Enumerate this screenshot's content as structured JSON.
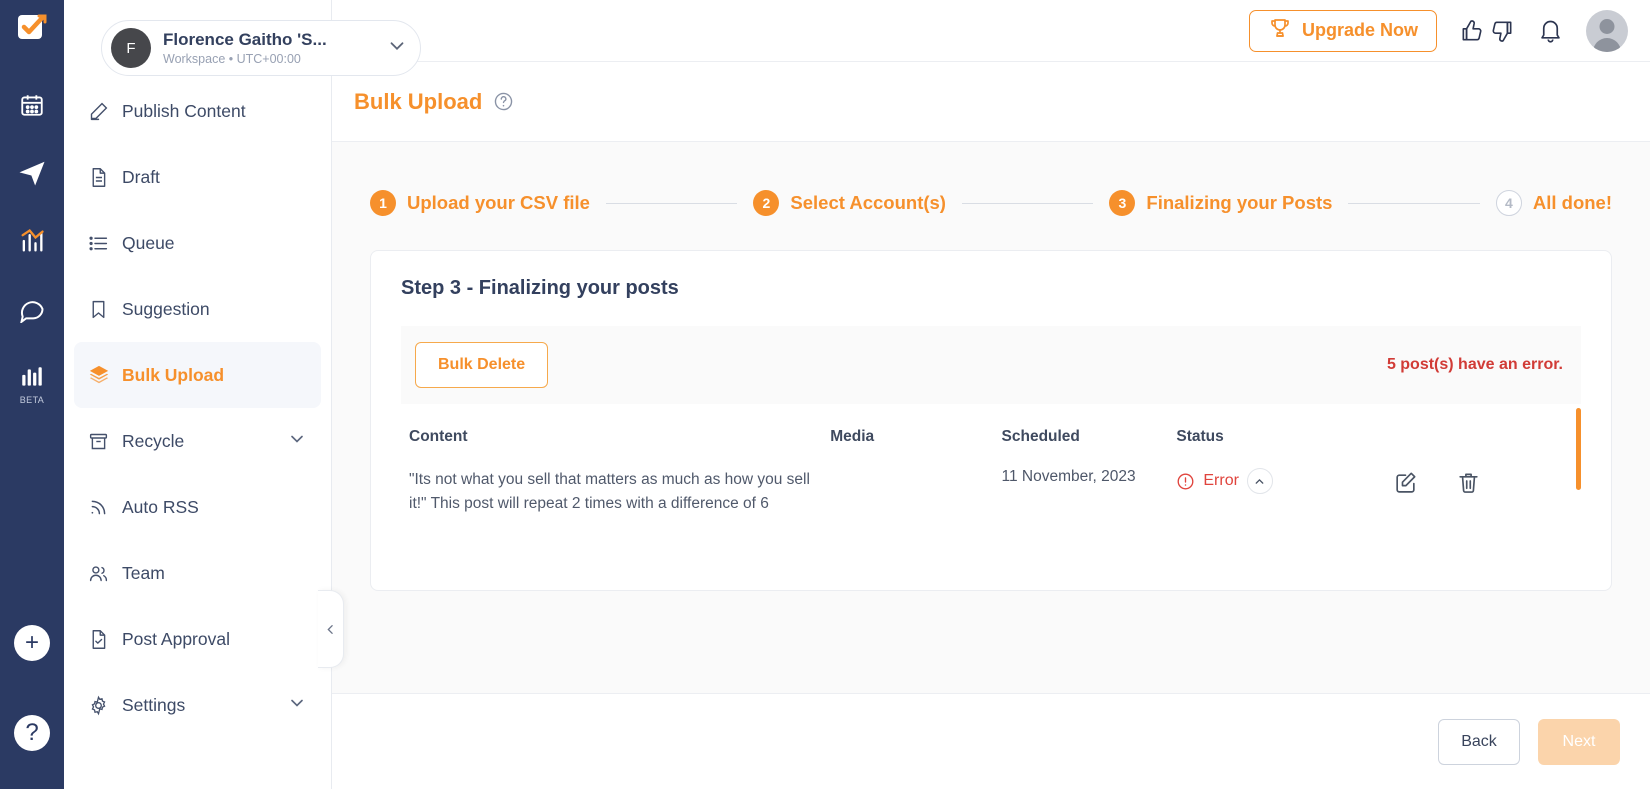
{
  "workspace": {
    "avatar_initial": "F",
    "name": "Florence Gaitho 'S...",
    "subtitle": "Workspace • UTC+00:00"
  },
  "topbar": {
    "upgrade_label": "Upgrade Now",
    "icons": [
      "trophy-icon",
      "thumbs-up-icon",
      "thumbs-down-icon",
      "bell-icon",
      "avatar"
    ]
  },
  "sidebar": {
    "items": [
      {
        "label": "Publish Content",
        "icon": "pencil-icon",
        "active": false,
        "chevron": false
      },
      {
        "label": "Draft",
        "icon": "document-icon",
        "active": false,
        "chevron": false
      },
      {
        "label": "Queue",
        "icon": "list-icon",
        "active": false,
        "chevron": false
      },
      {
        "label": "Suggestion",
        "icon": "bookmark-icon",
        "active": false,
        "chevron": false
      },
      {
        "label": "Bulk Upload",
        "icon": "layers-icon",
        "active": true,
        "chevron": false
      },
      {
        "label": "Recycle",
        "icon": "archive-icon",
        "active": false,
        "chevron": true
      },
      {
        "label": "Auto RSS",
        "icon": "rss-icon",
        "active": false,
        "chevron": false
      },
      {
        "label": "Team",
        "icon": "users-icon",
        "active": false,
        "chevron": false
      },
      {
        "label": "Post Approval",
        "icon": "document-check-icon",
        "active": false,
        "chevron": false
      },
      {
        "label": "Settings",
        "icon": "gear-icon",
        "active": false,
        "chevron": true
      }
    ]
  },
  "rail": {
    "items": [
      "calendar-icon",
      "paper-plane-icon",
      "analytics-icon",
      "chat-icon",
      "reports-icon"
    ],
    "beta_badge": "BETA",
    "add_label": "+",
    "help_label": "?"
  },
  "page": {
    "title": "Bulk Upload",
    "help_icon": "question-circle-icon"
  },
  "stepper": {
    "steps": [
      {
        "num": "1",
        "label": "Upload your CSV file",
        "state": "done"
      },
      {
        "num": "2",
        "label": "Select Account(s)",
        "state": "done"
      },
      {
        "num": "3",
        "label": "Finalizing your Posts",
        "state": "active"
      },
      {
        "num": "4",
        "label": "All done!",
        "state": "pending"
      }
    ]
  },
  "card": {
    "title": "Step 3 - Finalizing your posts",
    "bulk_delete_label": "Bulk Delete",
    "error_note": "5 post(s) have an error."
  },
  "table": {
    "headers": [
      "Content",
      "Media",
      "Scheduled",
      "Status",
      ""
    ],
    "rows": [
      {
        "content": "\"Its not what you sell that matters as much as how you sell it!\" This post will repeat 2 times with a difference of 6",
        "media": "",
        "scheduled": "11 November, 2023",
        "status": "Error",
        "status_icon": "error-circle-icon",
        "expand_icon": "chevron-up-icon",
        "edit_icon": "edit-icon",
        "delete_icon": "trash-icon"
      }
    ]
  },
  "footer": {
    "back_label": "Back",
    "next_label": "Next"
  },
  "colors": {
    "accent": "#f6902c",
    "navy": "#2b3a63",
    "error": "#e0443d",
    "title": "#33405e"
  }
}
